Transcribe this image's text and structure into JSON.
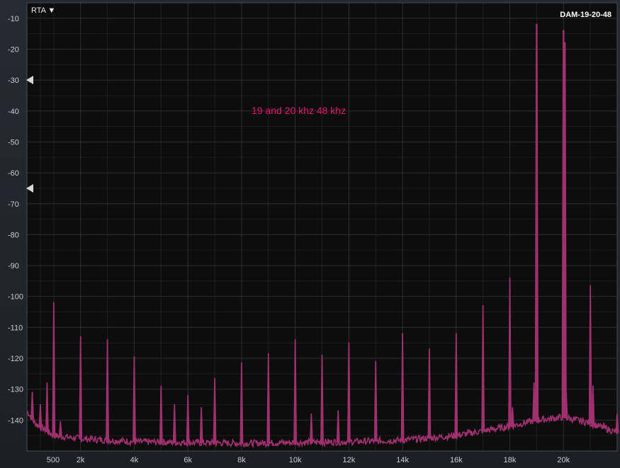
{
  "header": {
    "menu_label": "RTA ▼",
    "trace_name": "DAM-19-20-48"
  },
  "annotation": "19 and 20 khz 48 khz",
  "markers": [
    {
      "name": "upper-level-marker",
      "value": -30
    },
    {
      "name": "lower-level-marker",
      "value": -65
    }
  ],
  "colors": {
    "background": "#0d0d0e",
    "grid": "#3a3a3c",
    "trace": "#a0306e",
    "annotation": "#e0196e"
  },
  "chart_data": {
    "type": "line",
    "title": "",
    "xlabel": "",
    "ylabel": "",
    "x_unit": "Hz",
    "y_unit": "dB",
    "xlim": [
      0,
      22000
    ],
    "ylim": [
      -150,
      -5
    ],
    "y_ticks": [
      -10,
      -20,
      -30,
      -40,
      -50,
      -60,
      -70,
      -80,
      -90,
      -100,
      -110,
      -120,
      -130,
      -140
    ],
    "y_tick_labels": [
      "-10",
      "-20",
      "-30",
      "-40",
      "-50",
      "-60",
      "-70",
      "-80",
      "-90",
      "-100",
      "-110",
      "-120",
      "-130",
      "-140"
    ],
    "x_ticks": [
      500,
      2000,
      4000,
      6000,
      8000,
      10000,
      12000,
      14000,
      16000,
      18000,
      20000
    ],
    "x_tick_labels": [
      "500",
      "2k",
      "4k",
      "6k",
      "8k",
      "10k",
      "12k",
      "14k",
      "16k",
      "18k",
      "20k"
    ],
    "grid": true,
    "series": [
      {
        "name": "DAM-19-20-48",
        "noise_floor": [
          [
            0,
            -137
          ],
          [
            300,
            -141
          ],
          [
            1000,
            -145
          ],
          [
            2000,
            -146
          ],
          [
            4000,
            -147
          ],
          [
            8000,
            -147.5
          ],
          [
            12000,
            -147
          ],
          [
            14000,
            -146.5
          ],
          [
            16000,
            -145
          ],
          [
            18000,
            -142
          ],
          [
            19000,
            -140
          ],
          [
            20000,
            -139
          ],
          [
            21000,
            -141
          ],
          [
            22000,
            -144
          ]
        ],
        "peaks": [
          [
            19000,
            -12
          ],
          [
            20000,
            -14
          ],
          [
            19000,
            -80
          ],
          [
            20050,
            -18
          ],
          [
            18000,
            -94
          ],
          [
            17000,
            -103
          ],
          [
            16000,
            -112
          ],
          [
            15000,
            -117
          ],
          [
            14000,
            -112
          ],
          [
            13000,
            -121
          ],
          [
            12000,
            -115
          ],
          [
            11000,
            -119
          ],
          [
            10000,
            -114
          ],
          [
            9000,
            -118.5
          ],
          [
            8000,
            -121.5
          ],
          [
            7000,
            -126.5
          ],
          [
            6000,
            -132
          ],
          [
            5000,
            -129
          ],
          [
            4000,
            -119.5
          ],
          [
            3000,
            -114
          ],
          [
            2000,
            -113
          ],
          [
            1000,
            -102
          ],
          [
            21000,
            -96.5
          ],
          [
            21100,
            -129
          ],
          [
            10600,
            -138
          ],
          [
            11600,
            -137
          ],
          [
            5500,
            -135
          ],
          [
            6500,
            -136
          ],
          [
            750,
            -128
          ],
          [
            500,
            -135
          ],
          [
            200,
            -131
          ],
          [
            1250,
            -140.5
          ],
          [
            3000,
            -140
          ],
          [
            18100,
            -136
          ],
          [
            18900,
            -128
          ],
          [
            20100,
            -131
          ],
          [
            21500,
            -141
          ],
          [
            22000,
            -138
          ]
        ]
      }
    ]
  }
}
